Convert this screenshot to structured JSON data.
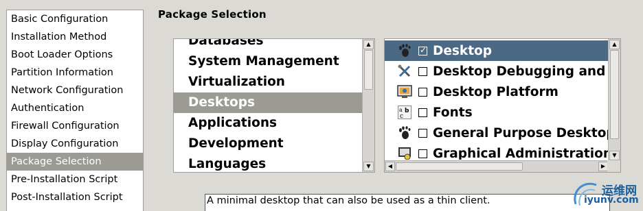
{
  "nav": {
    "items": [
      {
        "label": "Basic Configuration"
      },
      {
        "label": "Installation Method"
      },
      {
        "label": "Boot Loader Options"
      },
      {
        "label": "Partition Information"
      },
      {
        "label": "Network Configuration"
      },
      {
        "label": "Authentication"
      },
      {
        "label": "Firewall Configuration"
      },
      {
        "label": "Display Configuration"
      },
      {
        "label": "Package Selection"
      },
      {
        "label": "Pre-Installation Script"
      },
      {
        "label": "Post-Installation Script"
      }
    ],
    "selected": "Package Selection"
  },
  "section_title": "Package Selection",
  "groups": {
    "items": [
      {
        "label": "Databases"
      },
      {
        "label": "System Management"
      },
      {
        "label": "Virtualization"
      },
      {
        "label": "Desktops"
      },
      {
        "label": "Applications"
      },
      {
        "label": "Development"
      },
      {
        "label": "Languages"
      }
    ],
    "selected": "Desktops"
  },
  "packages": {
    "items": [
      {
        "label": "Desktop",
        "checked": true,
        "icon": "gnome-foot-icon"
      },
      {
        "label": "Desktop Debugging and P",
        "checked": false,
        "icon": "tools-icon"
      },
      {
        "label": "Desktop Platform",
        "checked": false,
        "icon": "monitor-icon"
      },
      {
        "label": "Fonts",
        "checked": false,
        "icon": "fonts-icon"
      },
      {
        "label": "General Purpose Desktop",
        "checked": false,
        "icon": "gnome-foot-icon"
      },
      {
        "label": "Graphical Administration",
        "checked": false,
        "icon": "admin-icon"
      }
    ],
    "selected": "Desktop"
  },
  "description": "A minimal desktop that can also be used as a thin client.",
  "watermark": {
    "cn": "运维网",
    "en": "iyunv.com"
  },
  "colors": {
    "selection_gray": "#9c9a94",
    "selection_blue": "#4b6983",
    "background": "#dcdad5"
  }
}
